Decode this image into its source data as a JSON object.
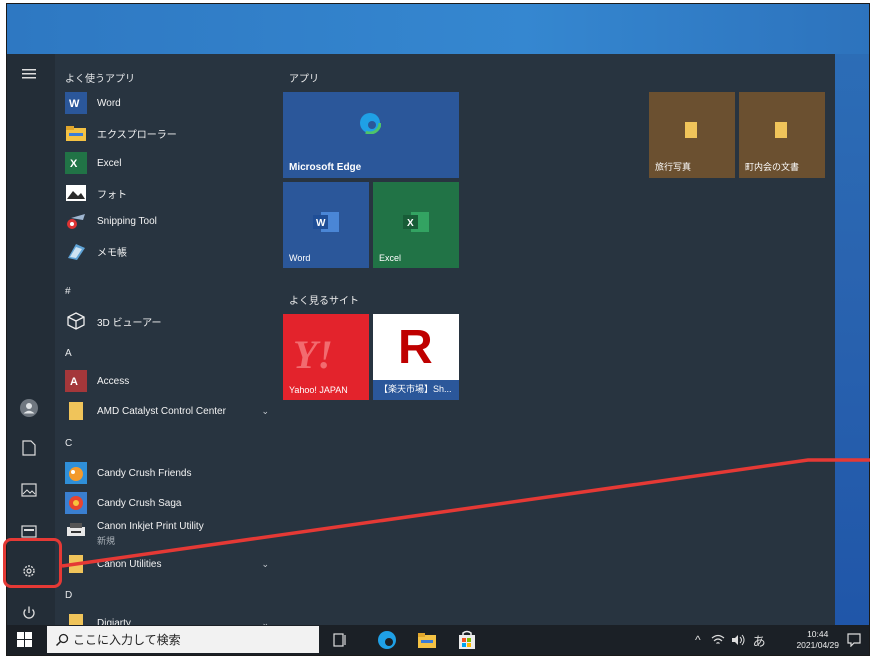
{
  "apps_section": {
    "frequent_header": "よく使うアプリ",
    "frequent": [
      {
        "label": "Word"
      },
      {
        "label": "エクスプローラー"
      },
      {
        "label": "Excel"
      },
      {
        "label": "フォト"
      },
      {
        "label": "Snipping Tool"
      },
      {
        "label": "メモ帳"
      }
    ],
    "group_hash": "#",
    "hash_apps": [
      {
        "label": "3D ビューアー"
      }
    ],
    "group_a": "A",
    "a_apps": [
      {
        "label": "Access"
      },
      {
        "label": "AMD Catalyst Control Center"
      }
    ],
    "group_c": "C",
    "c_apps": [
      {
        "label": "Candy Crush Friends"
      },
      {
        "label": "Candy Crush Saga"
      },
      {
        "label": "Canon Inkjet Print Utility",
        "sub": "新規"
      },
      {
        "label": "Canon Utilities"
      }
    ],
    "group_d": "D",
    "d_apps": [
      {
        "label": "Digiarty"
      }
    ]
  },
  "tiles": {
    "apps_header": "アプリ",
    "edge": "Microsoft Edge",
    "word": "Word",
    "excel": "Excel",
    "sites_header": "よく見るサイト",
    "yahoo": "Yahoo! JAPAN",
    "rakuten": "【楽天市場】Sh...",
    "rakuten_letter": "R",
    "folder1": "旅行写真",
    "folder2": "町内会の文書"
  },
  "taskbar": {
    "search_placeholder": "ここに入力して検索",
    "ime": "あ",
    "time": "10:44",
    "date": "2021/04/29"
  },
  "colors": {
    "annotation": "#e53935",
    "word": "#2b579a",
    "excel": "#217346",
    "access": "#a4373a",
    "edge_tile": "#2b579a",
    "yahoo": "#e3232c",
    "folder_tile": "#6b5030"
  }
}
